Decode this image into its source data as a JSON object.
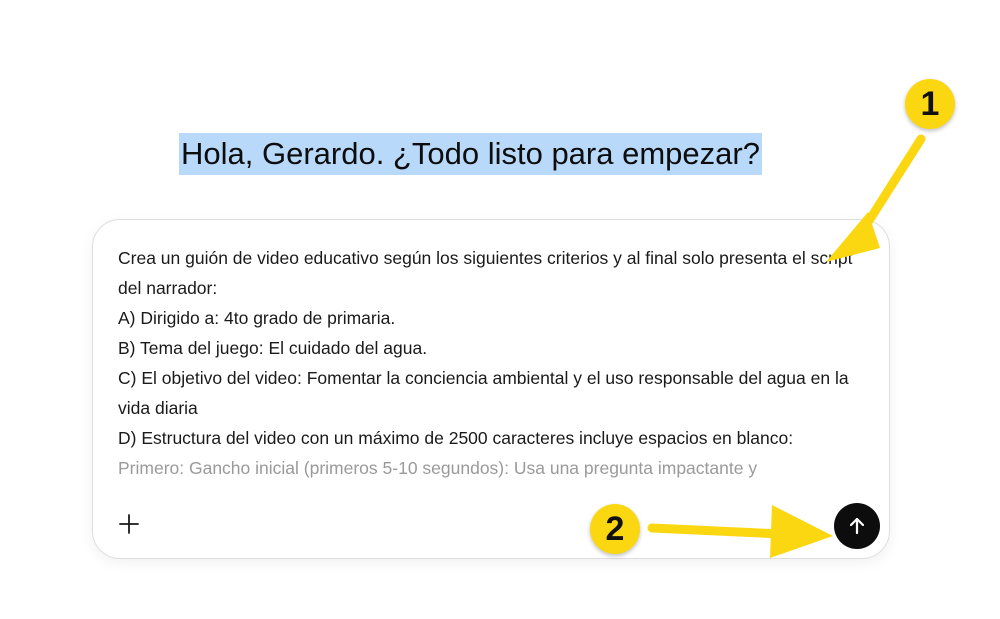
{
  "greeting": "Hola, Gerardo. ¿Todo listo para empezar?",
  "composer": {
    "lines": [
      "Crea un guión de video educativo según los siguientes criterios y al final solo presenta el script del narrador:",
      "A) Dirigido a: 4to grado de primaria.",
      "B) Tema del juego:  El cuidado del agua.",
      "C) El objetivo del video: Fomentar la conciencia ambiental y el uso responsable del agua en la vida diaria",
      "D) Estructura del video con un máximo de 2500 caracteres incluye espacios en blanco:",
      "Primero: Gancho inicial (primeros 5-10 segundos): Usa una pregunta impactante y"
    ],
    "add_icon": "plus-icon",
    "send_icon": "arrow-up-icon"
  },
  "annotations": {
    "badge_1": "1",
    "badge_2": "2",
    "color": "#fbd712"
  }
}
